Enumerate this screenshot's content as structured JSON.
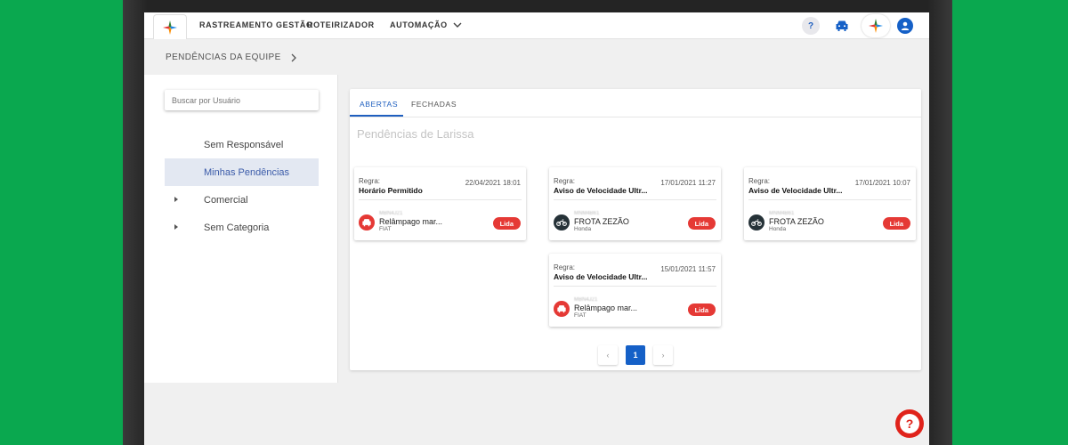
{
  "nav": {
    "items": [
      "RASTREAMENTO",
      "GESTÃO",
      "ROTEIRIZADOR",
      "AUTOMAÇÃO"
    ],
    "help_label": "?"
  },
  "breadcrumb": {
    "label": "PENDÊNCIAS DA EQUIPE"
  },
  "search": {
    "placeholder": "Buscar por Usuário"
  },
  "sidebar": {
    "items": [
      {
        "label": "Sem Responsável"
      },
      {
        "label": "Minhas Pendências"
      },
      {
        "label": "Comercial"
      },
      {
        "label": "Sem Categoria"
      }
    ]
  },
  "tabs": [
    "ABERTAS",
    "FECHADAS"
  ],
  "section_title": "Pendências de Larissa",
  "cards": [
    {
      "regra_label": "Regra:",
      "rule": "Horário Permitido",
      "date": "22/04/2021 18:01",
      "plate": "MBN4J21",
      "vehicle_name": "Relâmpago mar...",
      "brand": "FIAT",
      "badge": "Lida",
      "icon": "car-icon",
      "icon_color": "#e53935"
    },
    {
      "regra_label": "Regra:",
      "rule": "Aviso de Velocidade Ultr...",
      "date": "17/01/2021 11:27",
      "plate": "MNM4B61",
      "vehicle_name": "FROTA ZEZÃO",
      "brand": "Honda",
      "badge": "Lida",
      "icon": "motorcycle-icon",
      "icon_color": "#263238"
    },
    {
      "regra_label": "Regra:",
      "rule": "Aviso de Velocidade Ultr...",
      "date": "17/01/2021 10:07",
      "plate": "MNM4B61",
      "vehicle_name": "FROTA ZEZÃO",
      "brand": "Honda",
      "badge": "Lida",
      "icon": "motorcycle-icon",
      "icon_color": "#263238"
    },
    {
      "regra_label": "Regra:",
      "rule": "Aviso de Velocidade Ultr...",
      "date": "15/01/2021 11:57",
      "plate": "MBN4J21",
      "vehicle_name": "Relâmpago mar...",
      "brand": "FIAT",
      "badge": "Lida",
      "icon": "car-icon",
      "icon_color": "#e53935"
    }
  ],
  "pagination": {
    "prev": "‹",
    "current": "1",
    "next": "›"
  },
  "colors": {
    "background": "#0aa84f",
    "primary": "#1560c7",
    "badge": "#e53935",
    "fab": "#e0231b"
  }
}
